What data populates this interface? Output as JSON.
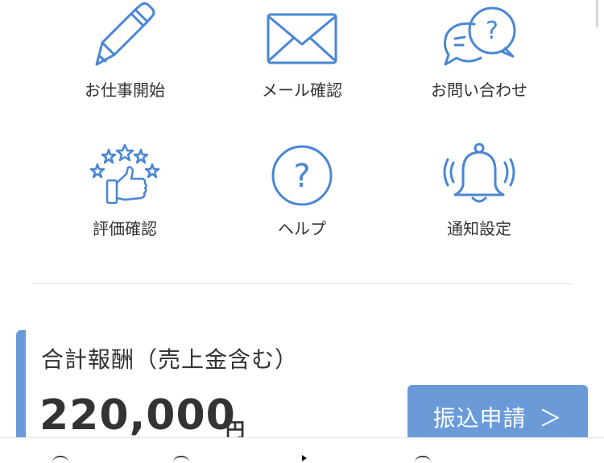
{
  "menu": {
    "items": [
      {
        "label": "お仕事開始",
        "icon": "pencil-icon"
      },
      {
        "label": "メール確認",
        "icon": "envelope-icon"
      },
      {
        "label": "お問い合わせ",
        "icon": "chat-bubbles-icon"
      },
      {
        "label": "評価確認",
        "icon": "thumbs-up-stars-icon"
      },
      {
        "label": "ヘルプ",
        "icon": "question-circle-icon"
      },
      {
        "label": "通知設定",
        "icon": "bell-icon"
      }
    ]
  },
  "reward": {
    "title": "合計報酬（売上金含む）",
    "amount": "220,000",
    "unit": "円"
  },
  "transfer": {
    "label": "振込申請",
    "chevron": "＞"
  },
  "colors": {
    "accent": "#6a9bd8",
    "icon_stroke": "#4a86d4",
    "text": "#333333"
  }
}
